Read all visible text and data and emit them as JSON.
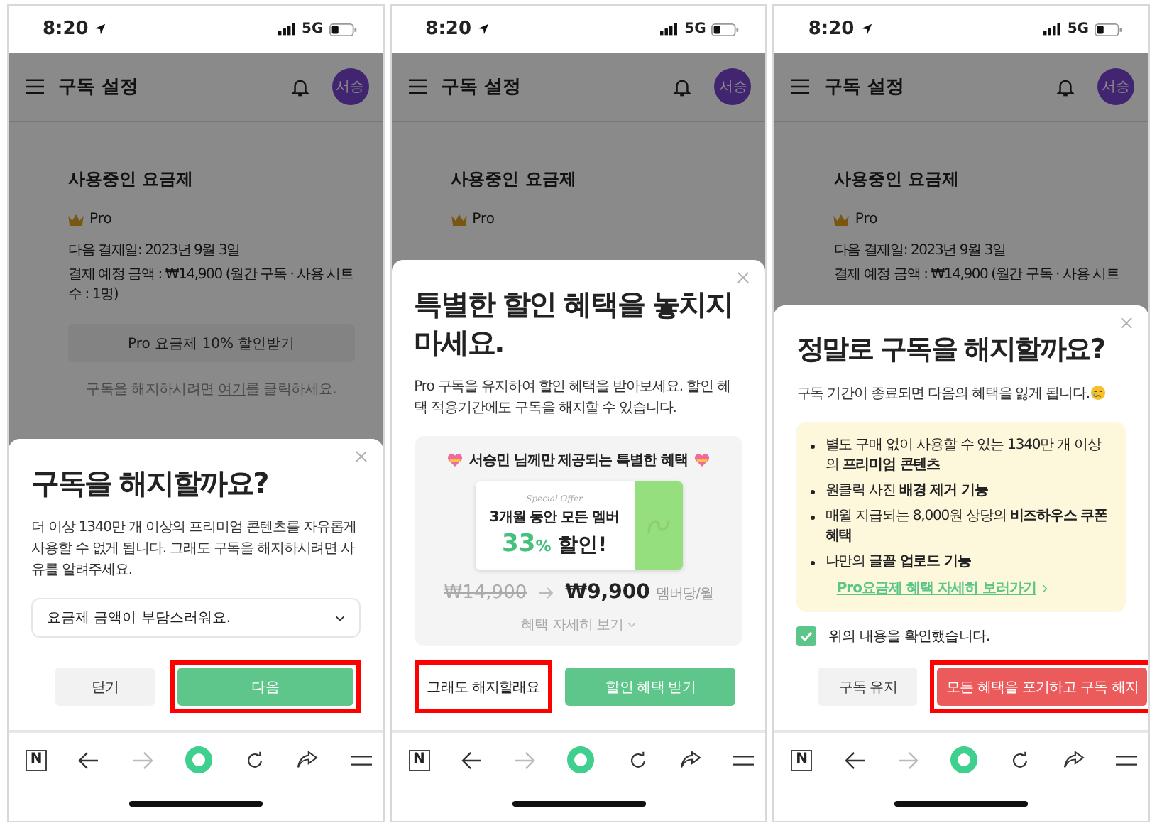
{
  "phones": [
    {
      "status": {
        "time": "8:20",
        "network": "5G"
      },
      "header": {
        "title": "구독 설정",
        "avatar": "서승"
      },
      "page": {
        "heading": "사용중인 요금제",
        "plan": "Pro",
        "next_payment": "다음 결제일: 2023년 9월 3일",
        "amount": "결제 예정 금액 : ₩14,900 (월간 구독 · 사용 시트 수 : 1명)",
        "discount_button": "Pro 요금제 10% 할인받기",
        "cancel_note": {
          "before": "구독을 해지하시려면 ",
          "link": "여기",
          "after": "를 클릭하세요."
        }
      },
      "sheet": {
        "kind": "reason",
        "title": "구독을 해지할까요?",
        "body": "더 이상 1340만 개 이상의 프리미엄 콘텐츠를 자유롭게 사용할 수 없게 됩니다. 그래도 구독을 해지하시려면 사유를 알려주세요.",
        "select": "요금제 금액이 부담스러워요.",
        "buttons": [
          {
            "label": "닫기",
            "kind": "secondary",
            "highlighted": false
          },
          {
            "label": "다음",
            "kind": "primary",
            "highlighted": true
          }
        ]
      },
      "toolbar": {
        "logo": "N"
      }
    },
    {
      "status": {
        "time": "8:20",
        "network": "5G"
      },
      "header": {
        "title": "구독 설정",
        "avatar": "서승"
      },
      "page": {
        "heading": "사용중인 요금제",
        "plan": "Pro"
      },
      "sheet": {
        "kind": "offer",
        "title": "특별한 할인 혜택을 놓치지 마세요.",
        "body": "Pro 구독을 유지하여 할인 혜택을 받아보세요. 할인 혜택 적용기간에도 구독을 해지할 수 있습니다.",
        "card": {
          "headline": "서승민 님께만 제공되는 특별한 혜택",
          "tag": "Special Offer",
          "line": "3개월 동안 모든 멤버",
          "percent": "33",
          "percent_sign": "%",
          "suffix": "할인!",
          "old_price": "₩14,900",
          "new_price": "₩9,900",
          "unit": "멤버당/월",
          "details": "혜택 자세히 보기"
        },
        "buttons": [
          {
            "label": "그래도 해지할래요",
            "kind": "text",
            "highlighted": true
          },
          {
            "label": "할인 혜택 받기",
            "kind": "primary",
            "highlighted": false
          }
        ]
      },
      "toolbar": {
        "logo": "N"
      }
    },
    {
      "status": {
        "time": "8:20",
        "network": "5G"
      },
      "header": {
        "title": "구독 설정",
        "avatar": "서승"
      },
      "page": {
        "heading": "사용중인 요금제",
        "plan": "Pro",
        "next_payment": "다음 결제일: 2023년 9월 3일",
        "amount": "결제 예정 금액 : ₩14,900 (월간 구독 · 사용 시트"
      },
      "sheet": {
        "kind": "confirm",
        "title": "정말로 구독을 해지할까요?",
        "body": "구독 기간이 종료되면 다음의 혜택을 잃게 됩니다.",
        "benefits": [
          "별도 구매 없이 사용할 수 있는 1340만 개 이상의 **프리미엄 콘텐츠**",
          "원클릭 사진 **배경 제거 기능**",
          "매월 지급되는 8,000원 상당의 **비즈하우스 쿠폰 혜택**",
          "나만의 **글꼴 업로드 기능**"
        ],
        "link": "Pro요금제 혜택 자세히 보러가기",
        "checkbox": {
          "label": "위의 내용을 확인했습니다.",
          "checked": true
        },
        "buttons": [
          {
            "label": "구독 유지",
            "kind": "secondary",
            "highlighted": false
          },
          {
            "label": "모든 혜택을 포기하고 구독 해지",
            "kind": "danger",
            "highlighted": true
          }
        ]
      },
      "toolbar": {
        "logo": "N"
      }
    }
  ]
}
